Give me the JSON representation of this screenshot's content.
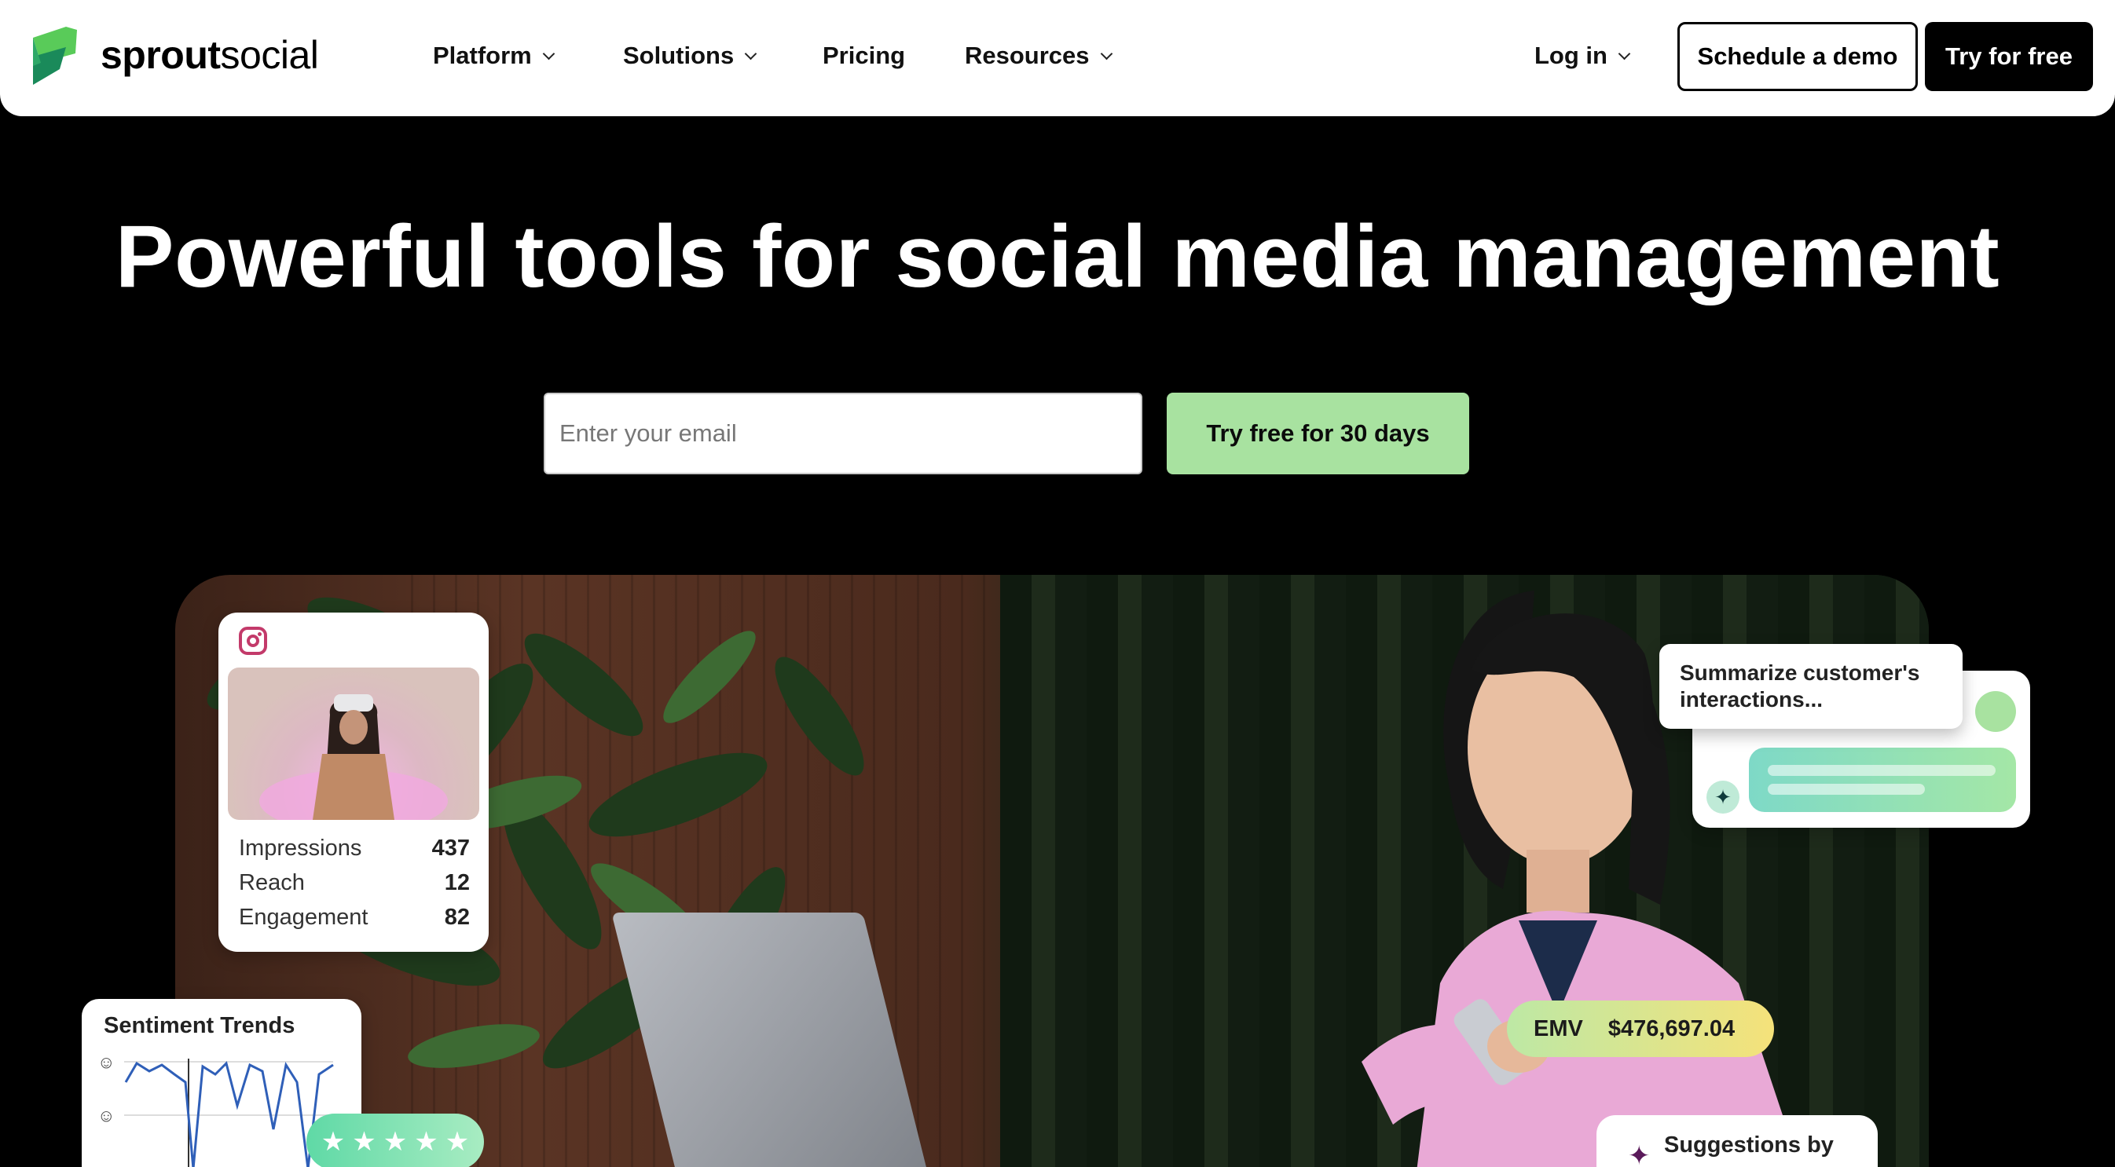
{
  "header": {
    "logo": {
      "bold": "sprout",
      "regular": "social"
    },
    "nav": [
      {
        "label": "Platform",
        "has_dropdown": true
      },
      {
        "label": "Solutions",
        "has_dropdown": true
      },
      {
        "label": "Pricing",
        "has_dropdown": false
      },
      {
        "label": "Resources",
        "has_dropdown": true
      }
    ],
    "login_label": "Log in",
    "demo_label": "Schedule a demo",
    "free_label": "Try for free"
  },
  "hero": {
    "title": "Powerful tools for social media management",
    "email_placeholder": "Enter your email",
    "cta_label": "Try free for 30 days"
  },
  "cards": {
    "insta": {
      "icon": "instagram-icon",
      "stats": [
        {
          "label": "Impressions",
          "value": "437"
        },
        {
          "label": "Reach",
          "value": "12"
        },
        {
          "label": "Engagement",
          "value": "82"
        }
      ]
    },
    "sentiment": {
      "title": "Sentiment Trends",
      "stars": 5
    },
    "ai_prompt": "Summarize customer's interactions...",
    "emv": {
      "label": "EMV",
      "value": "$476,697.04"
    },
    "suggestions": "Suggestions by"
  },
  "colors": {
    "brand_green": "#59cb59",
    "cta_green": "#a8e2a0",
    "instagram": "#c33a6a"
  }
}
